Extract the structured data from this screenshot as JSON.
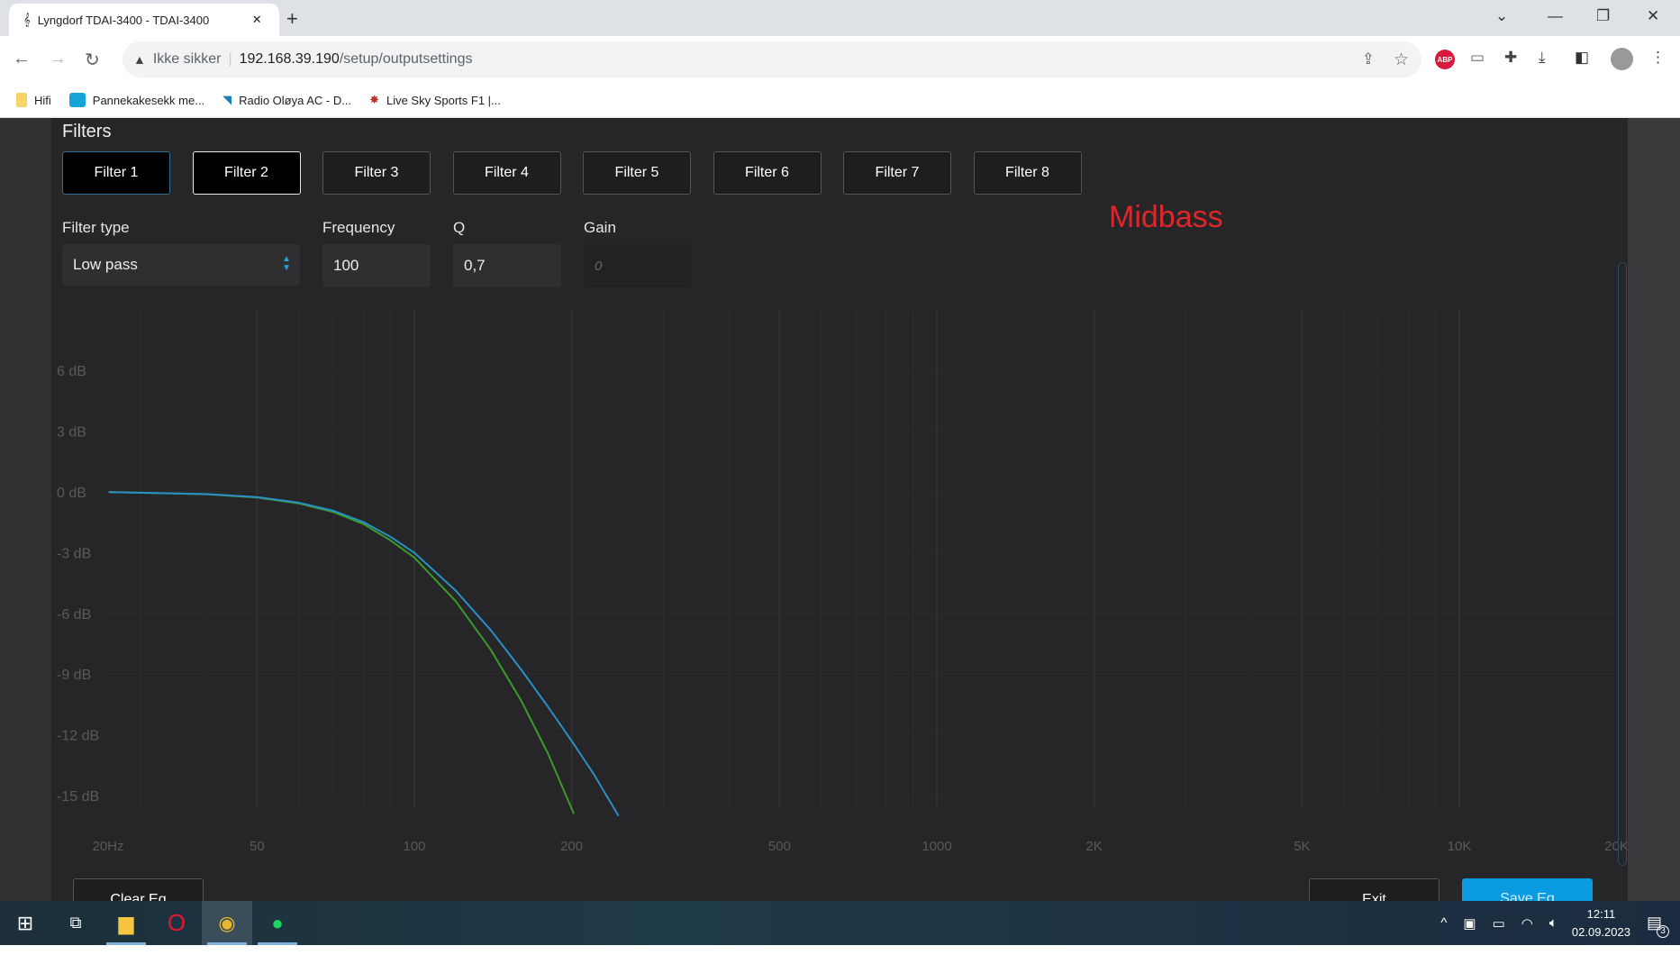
{
  "browser": {
    "tab_title": "Lyngdorf TDAI-3400 - TDAI-3400",
    "security": "Ikke sikker",
    "url_host": "192.168.39.190",
    "url_path": "/setup/outputsettings",
    "bookmarks": [
      {
        "label": "Hifi",
        "icon": "folder-icon"
      },
      {
        "label": "Pannekakesekk me...",
        "icon": "nrk-icon"
      },
      {
        "label": "Radio Oløya AC - D...",
        "icon": "radio-icon"
      },
      {
        "label": "Live Sky Sports F1 |...",
        "icon": "sports-icon"
      }
    ],
    "extensions": [
      "share-icon",
      "star-icon",
      "abp-icon",
      "cast-icon",
      "puzzle-icon",
      "download-icon",
      "sidepanel-icon",
      "avatar",
      "menu-icon"
    ]
  },
  "filters": {
    "title": "Filters",
    "buttons": [
      "Filter 1",
      "Filter 2",
      "Filter 3",
      "Filter 4",
      "Filter 5",
      "Filter 6",
      "Filter 7",
      "Filter 8"
    ],
    "active": "Filter 2",
    "filter_type_label": "Filter type",
    "filter_type_value": "Low pass",
    "frequency_label": "Frequency",
    "frequency_value": "100",
    "q_label": "Q",
    "q_value": "0,7",
    "gain_label": "Gain",
    "gain_placeholder": "0"
  },
  "annotation": {
    "text": "Midbass",
    "color": "#e0262a"
  },
  "actions": {
    "clear": "Clear Eq",
    "exit": "Exit",
    "save": "Save Eq",
    "save_color": "#0a9be0"
  },
  "chart_data": {
    "type": "line",
    "xscale": "log",
    "xlim": [
      26,
      20000
    ],
    "ylim": [
      -16,
      8.5
    ],
    "grid": true,
    "x_ticks": [
      {
        "value": 20,
        "label": "20Hz"
      },
      {
        "value": 50,
        "label": "50"
      },
      {
        "value": 100,
        "label": "100"
      },
      {
        "value": 200,
        "label": "200"
      },
      {
        "value": 500,
        "label": "500"
      },
      {
        "value": 1000,
        "label": "1000"
      },
      {
        "value": 2000,
        "label": "2K"
      },
      {
        "value": 5000,
        "label": "5K"
      },
      {
        "value": 10000,
        "label": "10K"
      },
      {
        "value": 20000,
        "label": "20K"
      }
    ],
    "y_ticks": [
      {
        "value": 6,
        "label": "6 dB"
      },
      {
        "value": 3,
        "label": "3 dB"
      },
      {
        "value": 0,
        "label": "0 dB"
      },
      {
        "value": -3,
        "label": "-3 dB"
      },
      {
        "value": -6,
        "label": "-6 dB"
      },
      {
        "value": -9,
        "label": "-9 dB"
      },
      {
        "value": -12,
        "label": "-12 dB"
      },
      {
        "value": -15,
        "label": "-15 dB"
      }
    ],
    "series": [
      {
        "color": "#3a9a2a",
        "x": [
          26,
          40,
          50,
          60,
          70,
          80,
          90,
          100,
          120,
          140,
          160,
          180,
          202
        ],
        "y": [
          -0.01,
          -0.12,
          -0.28,
          -0.57,
          -1.0,
          -1.6,
          -2.4,
          -3.25,
          -5.4,
          -7.8,
          -10.3,
          -12.9,
          -15.9
        ]
      },
      {
        "color": "#2a8fc4",
        "x": [
          26,
          40,
          50,
          60,
          70,
          80,
          90,
          100,
          120,
          140,
          160,
          180,
          200,
          220,
          246
        ],
        "y": [
          -0.02,
          -0.11,
          -0.26,
          -0.53,
          -0.94,
          -1.5,
          -2.22,
          -3.01,
          -4.88,
          -6.83,
          -8.77,
          -10.6,
          -12.3,
          -13.9,
          -16.0
        ]
      }
    ]
  },
  "taskbar": {
    "time": "12:11",
    "date": "02.09.2023",
    "notifications": "3"
  }
}
